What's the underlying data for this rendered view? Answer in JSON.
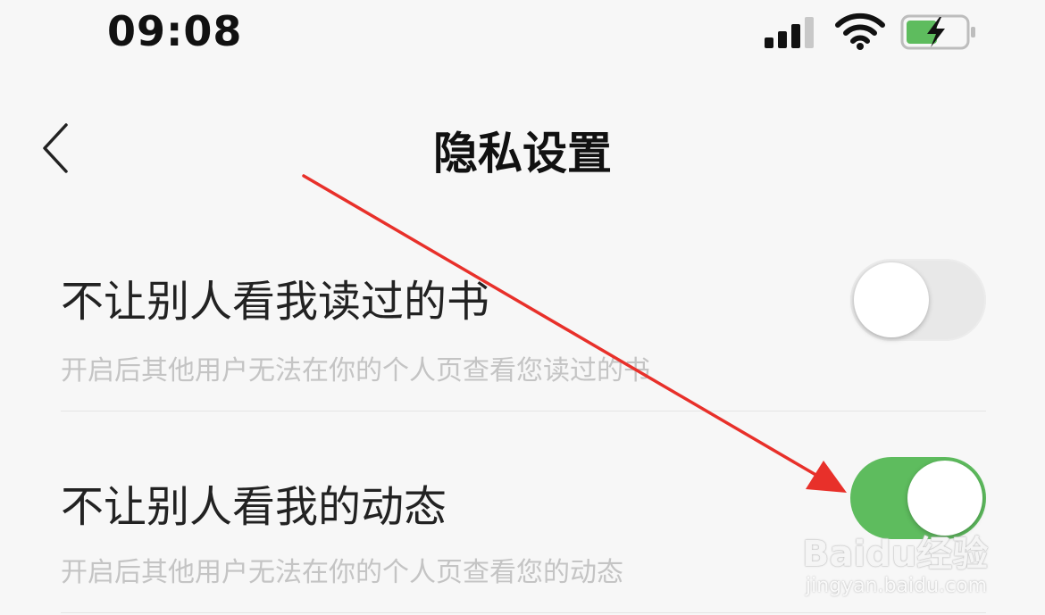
{
  "status_bar": {
    "time": "09:08",
    "signal_icon": "cellular-signal-icon",
    "wifi_icon": "wifi-icon",
    "battery_icon": "battery-charging-icon",
    "battery_color": "#5ebc5e"
  },
  "nav": {
    "back_icon": "chevron-left-icon",
    "title": "隐私设置"
  },
  "settings": [
    {
      "title": "不让别人看我读过的书",
      "description": "开启后其他用户无法在你的个人页查看您读过的书",
      "enabled": false
    },
    {
      "title": "不让别人看我的动态",
      "description": "开启后其他用户无法在你的个人页查看您的动态",
      "enabled": true
    }
  ],
  "colors": {
    "toggle_on": "#5ebc5e",
    "toggle_off": "#e8e8e8",
    "annotation_arrow": "#e8302a"
  },
  "watermark": {
    "brand": "Baidu经验",
    "url": "jingyan.baidu.com"
  }
}
